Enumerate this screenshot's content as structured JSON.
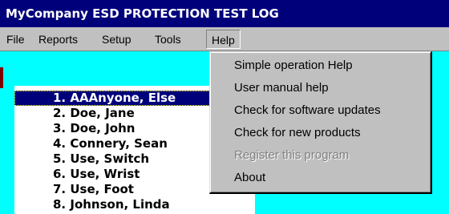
{
  "window": {
    "title": "MyCompany ESD PROTECTION TEST LOG"
  },
  "menubar": {
    "items": [
      {
        "label": "File"
      },
      {
        "label": "Reports"
      },
      {
        "label": "Setup"
      },
      {
        "label": "Tools"
      },
      {
        "label": "Help"
      }
    ]
  },
  "list": {
    "items": [
      {
        "label": "1. AAAnyone, Else",
        "selected": true
      },
      {
        "label": "2. Doe, Jane"
      },
      {
        "label": "3. Doe, John"
      },
      {
        "label": "4. Connery, Sean"
      },
      {
        "label": "5. Use, Switch"
      },
      {
        "label": "6. Use, Wrist"
      },
      {
        "label": "7. Use, Foot"
      },
      {
        "label": "8. Johnson, Linda"
      }
    ]
  },
  "help_menu": {
    "items": [
      {
        "label": "Simple operation Help",
        "enabled": true
      },
      {
        "label": "User manual help",
        "enabled": true
      },
      {
        "label": "Check for software updates",
        "enabled": true
      },
      {
        "label": "Check for new products",
        "enabled": true
      },
      {
        "label": "Register this program",
        "enabled": false
      },
      {
        "label": "About",
        "enabled": true
      }
    ]
  },
  "colors": {
    "titlebar": "#00007b",
    "background": "#00ffff",
    "menu": "#c0c0c0",
    "selection": "#00007b"
  }
}
